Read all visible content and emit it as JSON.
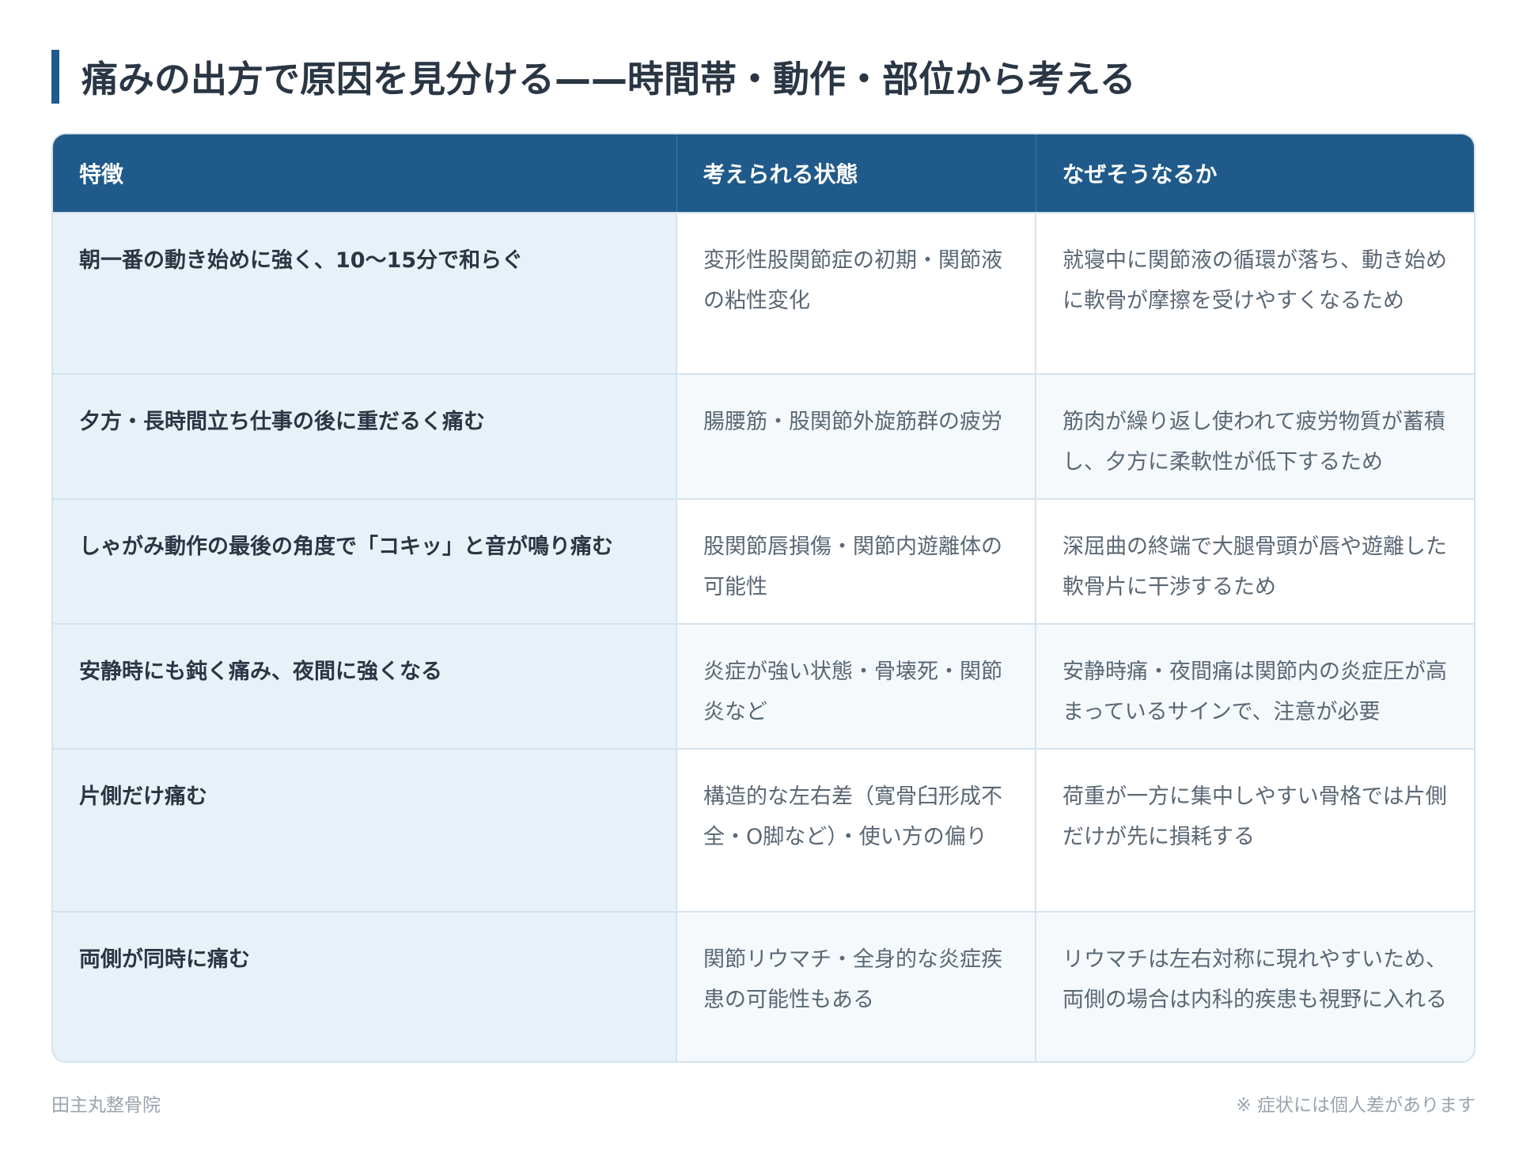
{
  "title": "痛みの出方で原因を見分ける——時間帯・動作・部位から考える",
  "table": {
    "headers": [
      "特徴",
      "考えられる状態",
      "なぜそうなるか"
    ],
    "rows": [
      {
        "feature": "朝一番の動き始めに強く、10〜15分で和らぐ",
        "condition": "変形性股関節症の初期・関節液の粘性変化",
        "reason": "就寝中に関節液の循環が落ち、動き始めに軟骨が摩擦を受けやすくなるため"
      },
      {
        "feature": "夕方・長時間立ち仕事の後に重だるく痛む",
        "condition": "腸腰筋・股関節外旋筋群の疲労",
        "reason": "筋肉が繰り返し使われて疲労物質が蓄積し、夕方に柔軟性が低下するため"
      },
      {
        "feature": "しゃがみ動作の最後の角度で「コキッ」と音が鳴り痛む",
        "condition": "股関節唇損傷・関節内遊離体の可能性",
        "reason": "深屈曲の終端で大腿骨頭が唇や遊離した軟骨片に干渉するため"
      },
      {
        "feature": "安静時にも鈍く痛み、夜間に強くなる",
        "condition": "炎症が強い状態・骨壊死・関節炎など",
        "reason": "安静時痛・夜間痛は関節内の炎症圧が高まっているサインで、注意が必要"
      },
      {
        "feature": "片側だけ痛む",
        "condition": "構造的な左右差（寛骨臼形成不全・O脚など）・使い方の偏り",
        "reason": "荷重が一方に集中しやすい骨格では片側だけが先に損耗する"
      },
      {
        "feature": "両側が同時に痛む",
        "condition": "関節リウマチ・全身的な炎症疾患の可能性もある",
        "reason": "リウマチは左右対称に現れやすいため、両側の場合は内科的疾患も視野に入れる"
      }
    ]
  },
  "footer": {
    "clinic": "田主丸整骨院",
    "note": "※ 症状には個人差があります"
  },
  "colors": {
    "header_bg": "#1f5a8a",
    "feature_col_bg": "#e8f1f8",
    "border": "#d4e3ee"
  }
}
